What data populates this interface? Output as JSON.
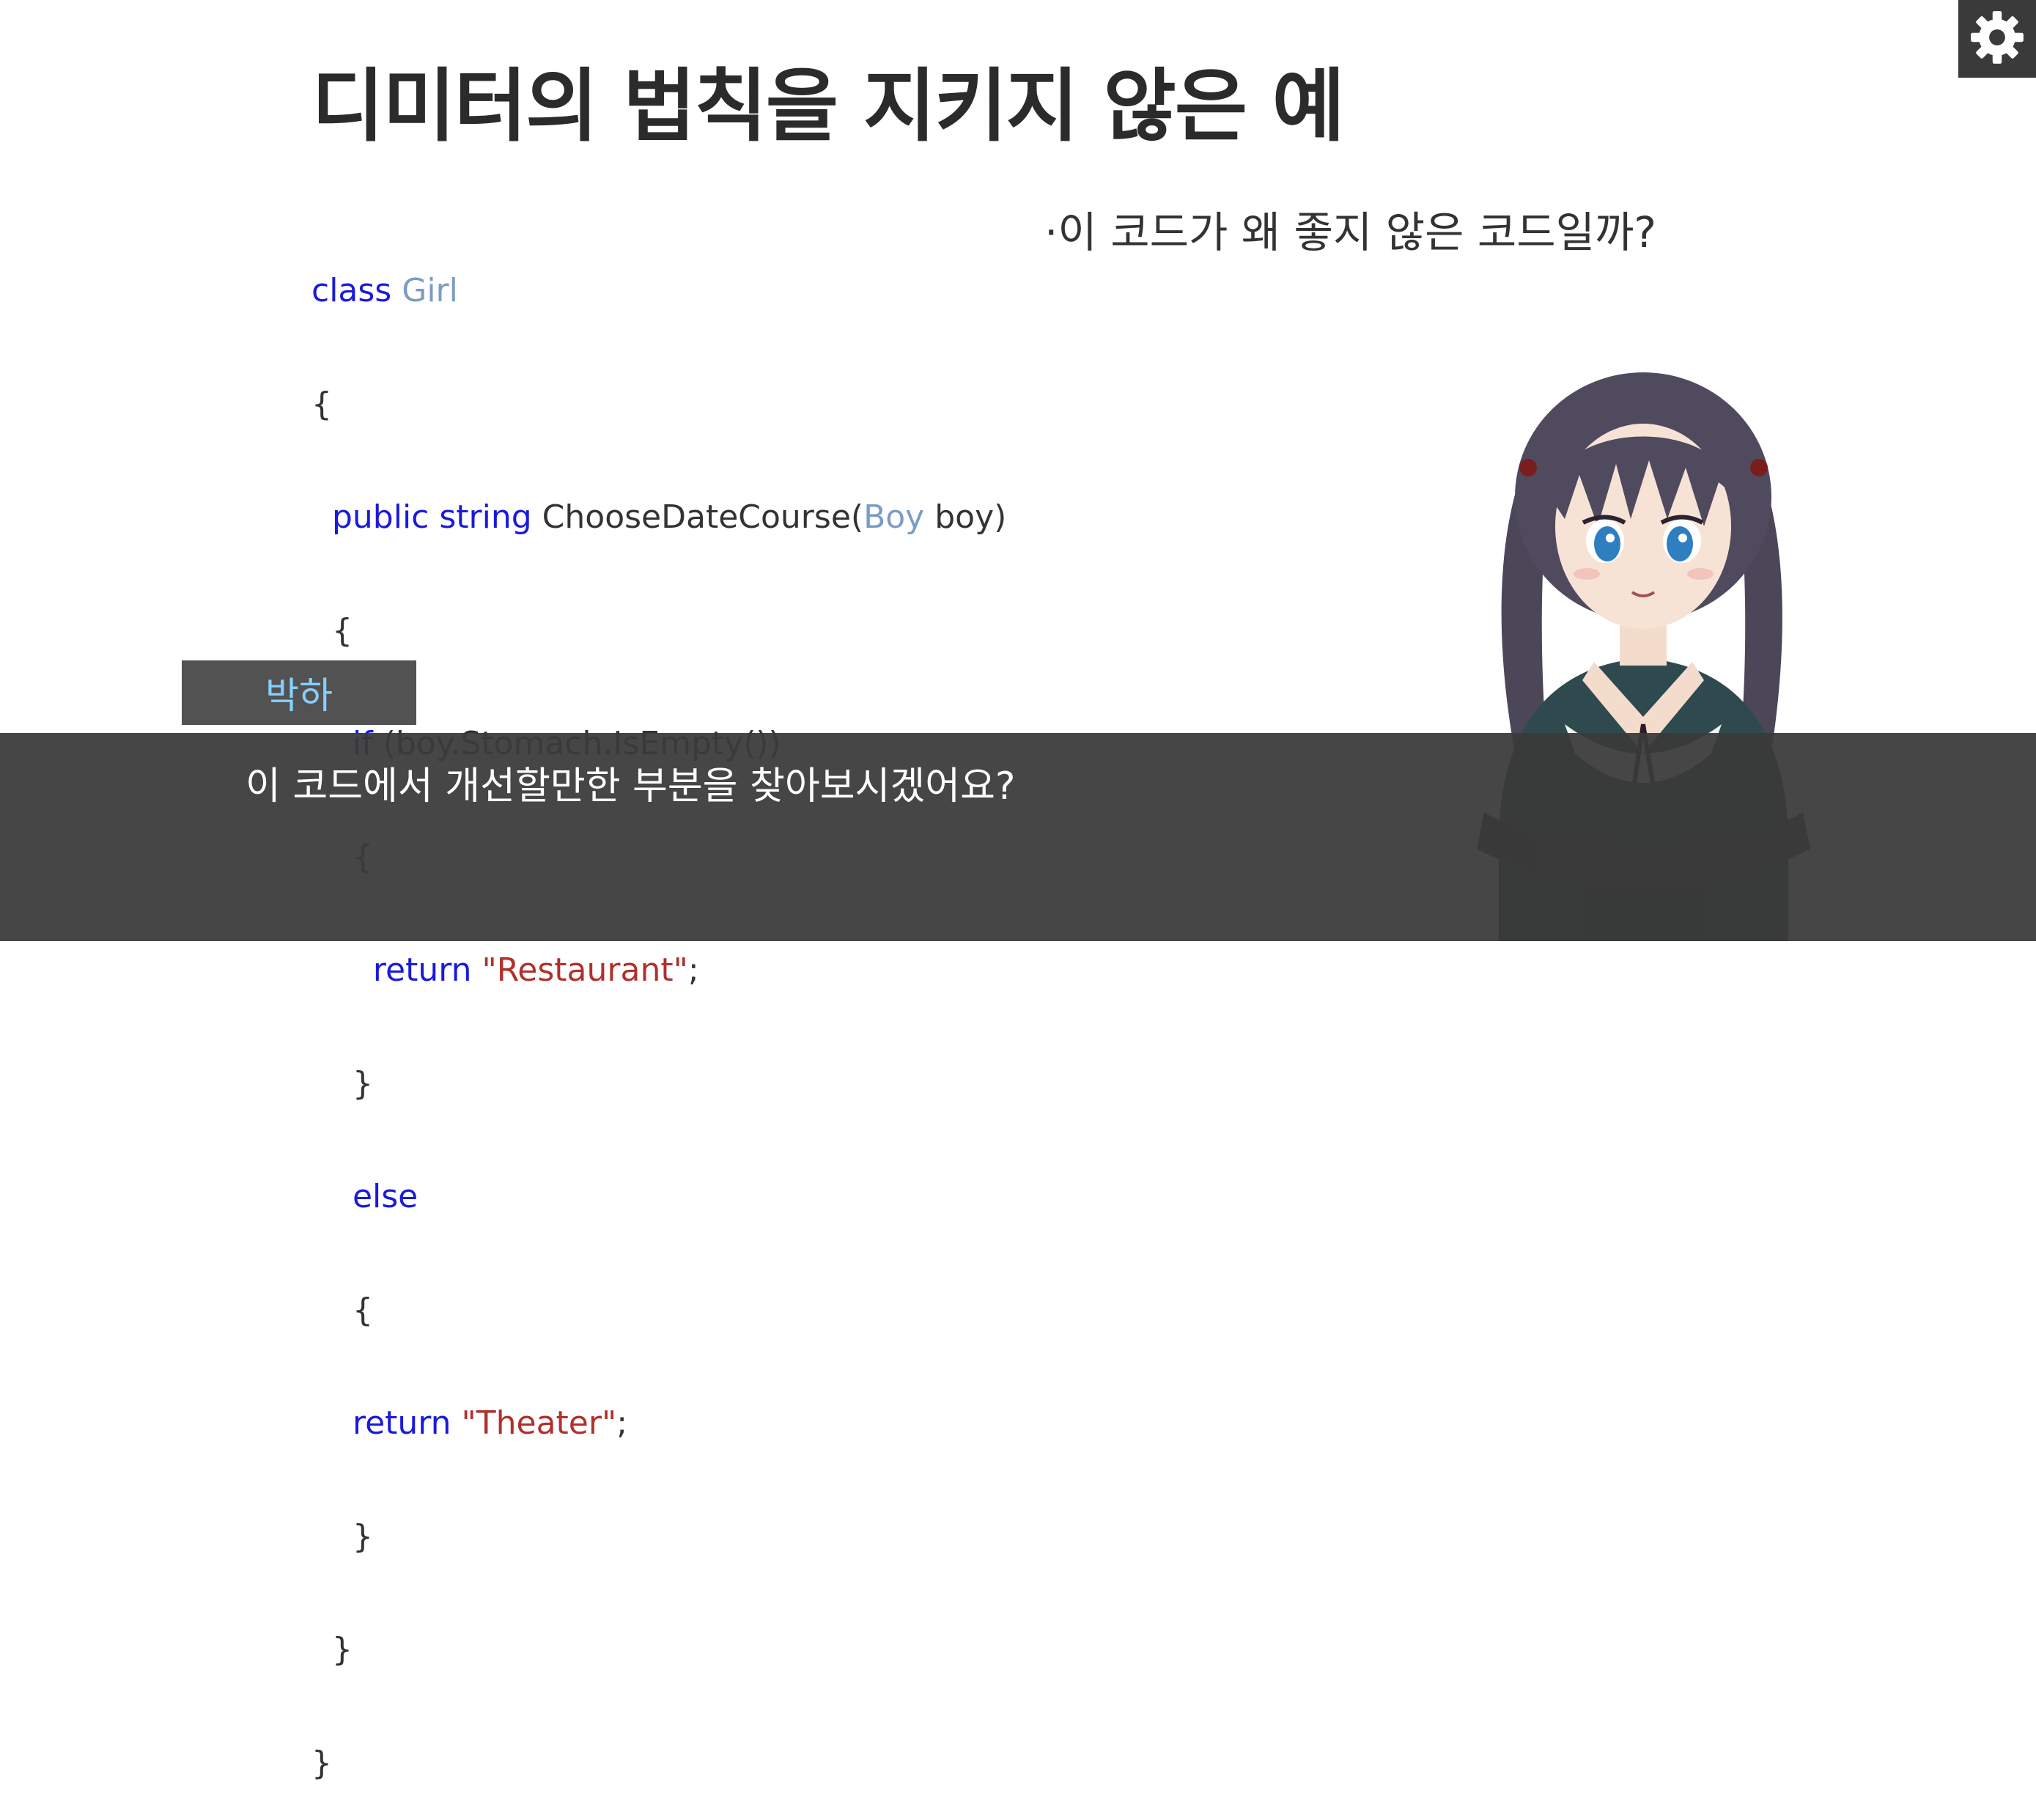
{
  "slide": {
    "title": "디미터의 법칙을 지키지 않은 예",
    "bullet": "·이 코드가 왜 좋지 않은 코드일까?"
  },
  "code": {
    "l1_kw": "class",
    "l1_type": "Girl",
    "l2": "{",
    "l3_kw": "public string",
    "l3_method": "ChooseDateCourse(",
    "l3_type": "Boy",
    "l3_rest": "boy)",
    "l4": "{",
    "l5_kw": "if",
    "l5_rest": "(boy.Stomach.IsEmpty())",
    "l6": "{",
    "l7_kw": "return",
    "l7_str": "\"Restaurant\"",
    "l7_end": ";",
    "l8": "}",
    "l9_kw": "else",
    "l10": "{",
    "l11_kw": "return",
    "l11_str": "\"Theater\"",
    "l11_end": ";",
    "l12": "}",
    "l13": "}",
    "l14": "}"
  },
  "dialog": {
    "speaker": "박하",
    "text": "이 코드에서 개선할만한 부분을 찾아보시겠어요?"
  },
  "toolbar": {
    "settings_icon": "gear-icon"
  },
  "colors": {
    "keyword": "#1a1adb",
    "type": "#7a9cc6",
    "string": "#b0302c",
    "speaker_name": "#87cfff",
    "dialog_bg": "#3a3a3a"
  }
}
